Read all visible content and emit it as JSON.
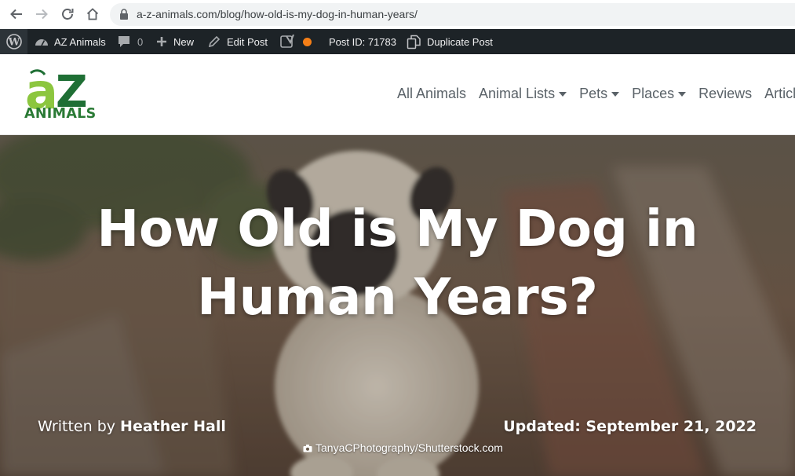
{
  "browser": {
    "url": "a-z-animals.com/blog/how-old-is-my-dog-in-human-years/"
  },
  "adminbar": {
    "site_name": "AZ Animals",
    "comments_count": "0",
    "new_label": "New",
    "edit_label": "Edit Post",
    "post_id": "Post ID: 71783",
    "duplicate_label": "Duplicate Post"
  },
  "logo": {
    "letters": "aZ",
    "wordmark": "ANIMALS"
  },
  "nav": {
    "items": [
      {
        "label": "All Animals",
        "dropdown": false
      },
      {
        "label": "Animal Lists",
        "dropdown": true
      },
      {
        "label": "Pets",
        "dropdown": true
      },
      {
        "label": "Places",
        "dropdown": true
      },
      {
        "label": "Reviews",
        "dropdown": false
      },
      {
        "label": "Article",
        "dropdown": false
      }
    ]
  },
  "hero": {
    "title": "How Old is My Dog in Human Years?",
    "written_by_prefix": "Written by ",
    "author": "Heather Hall",
    "updated": "Updated: September 21, 2022",
    "photo_credit": "TanyaCPhotography/Shutterstock.com"
  },
  "colors": {
    "adminbar_bg": "#1d2327",
    "logo_light_green": "#8cc63f",
    "logo_dark_green": "#1f6f35",
    "nav_text": "#5a6268",
    "status_dot": "#f57f17"
  }
}
